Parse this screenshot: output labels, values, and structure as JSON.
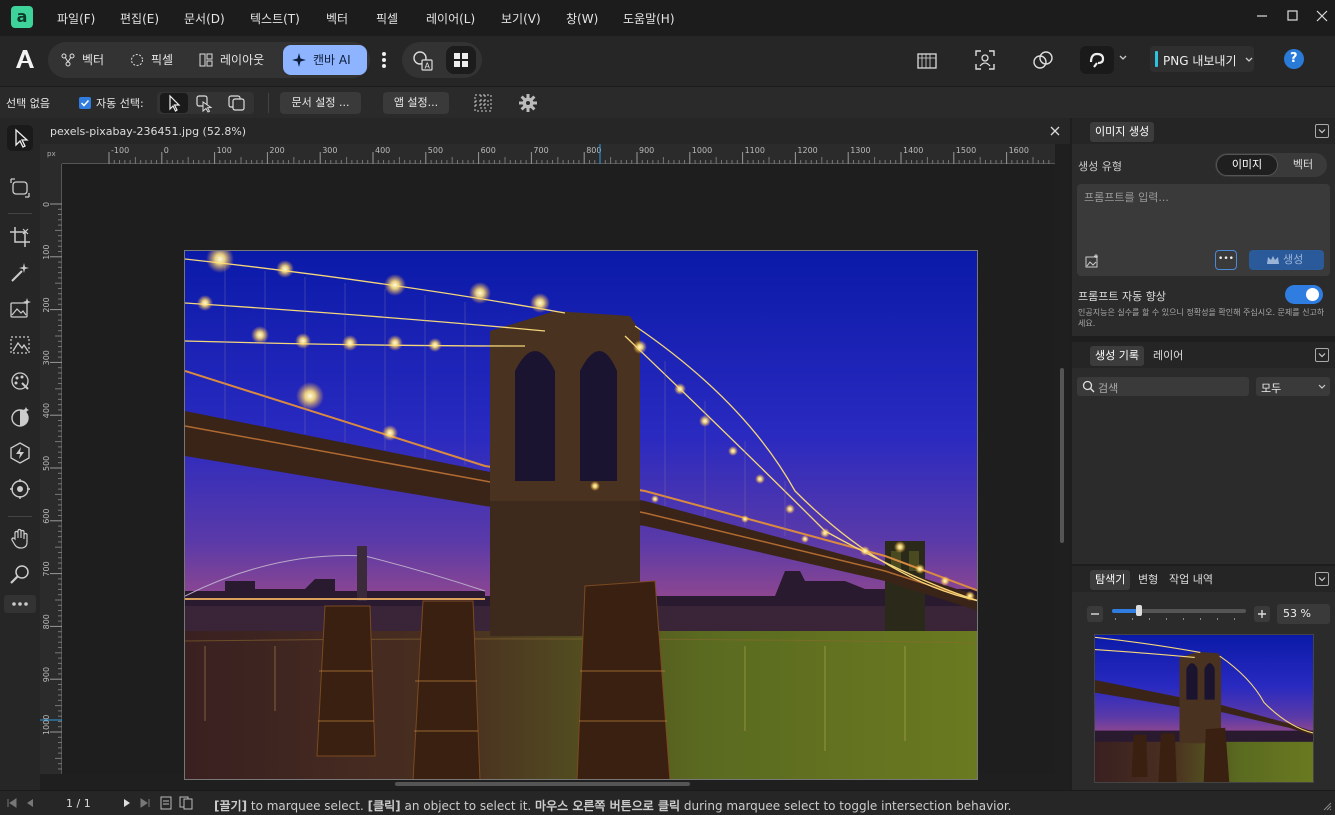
{
  "menubar": {
    "items": [
      "파일(F)",
      "편집(E)",
      "문서(D)",
      "텍스트(T)",
      "벡터",
      "픽셀",
      "레이어(L)",
      "보기(V)",
      "창(W)",
      "도움말(H)"
    ]
  },
  "toolbar": {
    "personas": [
      "벡터",
      "픽셀",
      "레이아웃",
      "캔바 AI"
    ],
    "export_label": "PNG 내보내기",
    "accent_color": "#8fb4ff"
  },
  "context": {
    "selection_status": "선택 없음",
    "auto_select_label": "자동 선택:",
    "doc_setup_label": "문서 설정 ...",
    "app_setup_label": "앱 설정..."
  },
  "document": {
    "tab_title": "pexels-pixabay-236451.jpg (52.8%)",
    "ruler_unit": "px",
    "hruler_ticks": [
      "-100",
      "0",
      "100",
      "200",
      "300",
      "400",
      "500",
      "600",
      "700",
      "800",
      "900",
      "1000",
      "1100",
      "1200",
      "1300",
      "1400",
      "1500",
      "1600"
    ],
    "vruler_ticks": [
      "0",
      "100",
      "200",
      "300",
      "400",
      "500",
      "600",
      "700",
      "800",
      "900",
      "1000"
    ]
  },
  "image_gen": {
    "tab_label": "이미지 생성",
    "type_label": "생성 유형",
    "type_options": [
      "이미지",
      "벡터"
    ],
    "prompt_placeholder": "프롬프트를 입력...",
    "more_label": "•••",
    "generate_label": "생성",
    "auto_enhance_label": "프롬프트 자동 향상",
    "auto_enhance_on": true,
    "disclaimer": "인공지능은 실수를 할 수 있으니 정확성을 확인해 주십시오. 문제를 신고하세요."
  },
  "history_panel": {
    "tabs": [
      "생성 기록",
      "레이어"
    ],
    "search_placeholder": "검색",
    "filter_value": "모두"
  },
  "navigator": {
    "tabs": [
      "탐색기",
      "변형",
      "작업 내역"
    ],
    "zoom_value": "53 %",
    "zoom_fraction": 0.53
  },
  "status": {
    "page_indicator": "1 / 1",
    "hint_parts": [
      "[끌기]",
      " to marquee select. ",
      "[클릭]",
      " an object to select it. ",
      "마우스 오른쪽 버튼으로 클릭",
      " during marquee select to toggle intersection behavior."
    ]
  }
}
